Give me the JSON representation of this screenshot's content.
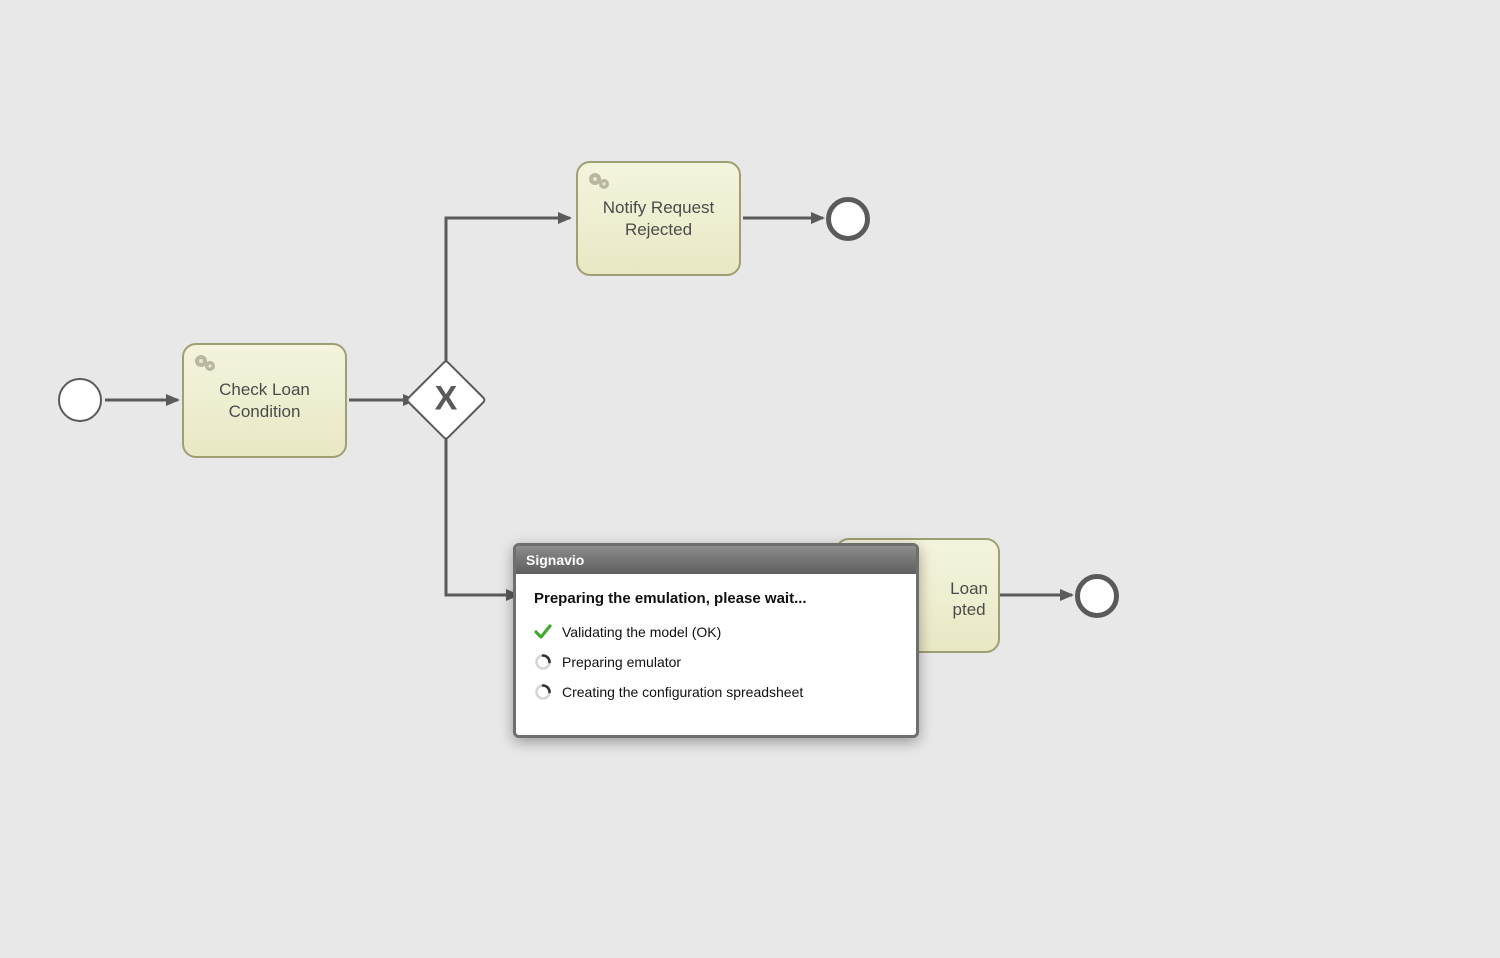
{
  "diagram": {
    "start_event": "",
    "task_check_loan": "Check Loan\nCondition",
    "gateway_type": "exclusive",
    "task_notify_rejected": "Notify Request\nRejected",
    "task_notify_accepted_partial": "Loan\npted",
    "end_event_top": "",
    "end_event_bottom": ""
  },
  "dialog": {
    "title": "Signavio",
    "heading": "Preparing the emulation, please wait...",
    "steps": [
      {
        "icon": "check",
        "label": "Validating the model (OK)"
      },
      {
        "icon": "spinner",
        "label": "Preparing emulator"
      },
      {
        "icon": "spinner",
        "label": "Creating the configuration spreadsheet"
      }
    ]
  }
}
